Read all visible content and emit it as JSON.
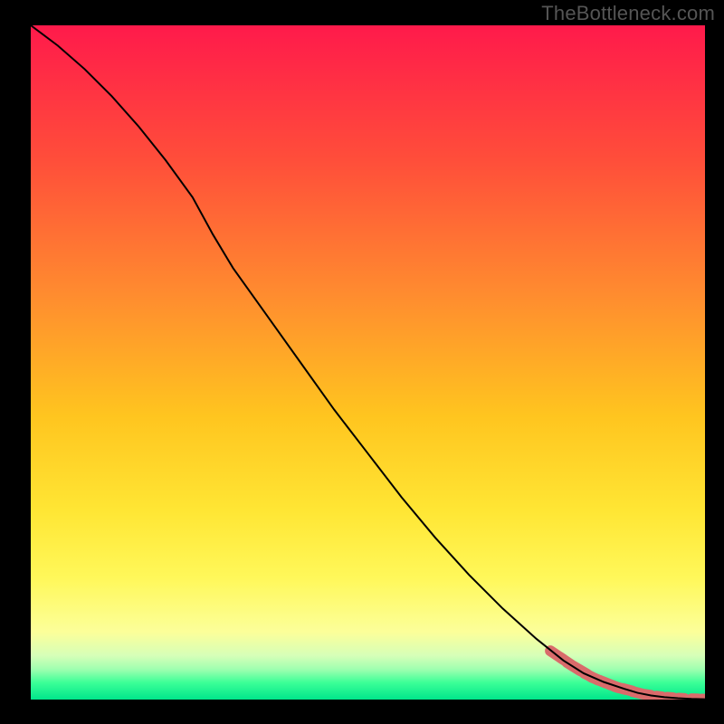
{
  "watermark": "TheBottleneck.com",
  "chart_data": {
    "type": "line",
    "title": "",
    "xlabel": "",
    "ylabel": "",
    "xlim": [
      0,
      100
    ],
    "ylim": [
      0,
      100
    ],
    "grid": false,
    "legend": false,
    "background_gradient_stops": [
      {
        "offset": 0.0,
        "color": "#ff1a4b"
      },
      {
        "offset": 0.2,
        "color": "#ff4e3a"
      },
      {
        "offset": 0.4,
        "color": "#ff8c2f"
      },
      {
        "offset": 0.58,
        "color": "#ffc51f"
      },
      {
        "offset": 0.72,
        "color": "#ffe634"
      },
      {
        "offset": 0.82,
        "color": "#fff85a"
      },
      {
        "offset": 0.9,
        "color": "#fcff9a"
      },
      {
        "offset": 0.935,
        "color": "#d6ffb8"
      },
      {
        "offset": 0.955,
        "color": "#9fffb0"
      },
      {
        "offset": 0.975,
        "color": "#3bff97"
      },
      {
        "offset": 1.0,
        "color": "#00e68b"
      }
    ],
    "series": [
      {
        "name": "curve",
        "type": "line",
        "color": "#000000",
        "stroke_width": 2,
        "x": [
          0,
          4,
          8,
          12,
          16,
          20,
          24,
          27,
          30,
          35,
          40,
          45,
          50,
          55,
          60,
          65,
          70,
          75,
          79,
          82,
          85,
          88,
          90,
          92,
          94,
          96,
          98,
          100
        ],
        "y": [
          100,
          97,
          93.5,
          89.5,
          85,
          80,
          74.5,
          69,
          64,
          57,
          50,
          43,
          36.5,
          30,
          24,
          18.5,
          13.5,
          9,
          5.8,
          3.9,
          2.6,
          1.6,
          1.0,
          0.6,
          0.35,
          0.2,
          0.1,
          0.05
        ]
      },
      {
        "name": "points",
        "type": "scatter",
        "color": "#d96b6b",
        "marker_radius": 6,
        "x": [
          78,
          79.5,
          80.5,
          81.5,
          82.3,
          83.1,
          84.2,
          85.5,
          86.5,
          87.4,
          88.5,
          90.0,
          91.5,
          93.2,
          94.8,
          96.5,
          98.5,
          100.0
        ],
        "y": [
          6.6,
          5.6,
          4.9,
          4.35,
          3.85,
          3.4,
          2.9,
          2.4,
          2.0,
          1.7,
          1.45,
          1.0,
          0.7,
          0.45,
          0.3,
          0.18,
          0.1,
          0.05
        ]
      }
    ]
  }
}
